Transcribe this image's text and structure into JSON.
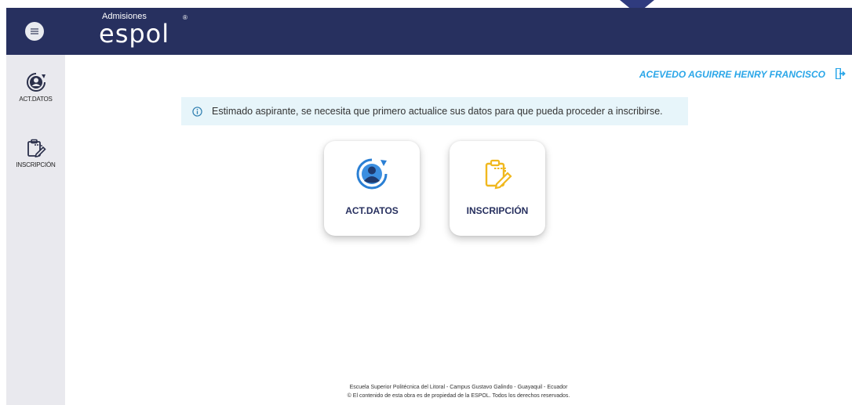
{
  "header": {
    "logo_small": "Admisiones",
    "logo_main": "espol",
    "logo_reg": "®"
  },
  "sidebar": {
    "items": [
      {
        "label": "ACT.DATOS",
        "icon": "user-refresh-icon"
      },
      {
        "label": "INSCRIPCIÓN",
        "icon": "clipboard-edit-icon"
      }
    ]
  },
  "user": {
    "name": "ACEVEDO AGUIRRE HENRY FRANCISCO"
  },
  "alert": {
    "message": "Estimado aspirante, se necesita que primero actualice sus datos para que pueda proceder a inscribirse."
  },
  "cards": [
    {
      "label": "ACT.DATOS",
      "icon": "user-refresh-icon"
    },
    {
      "label": "INSCRIPCIÓN",
      "icon": "clipboard-edit-icon"
    }
  ],
  "footer": {
    "line1": "Escuela Superior Politécnica del Litoral - Campus Gustavo Galindo - Guayaquil - Ecuador",
    "line2": "© El contenido de esta obra es de propiedad de la ESPOL. Todos los derechos reservados."
  },
  "colors": {
    "header_bg": "#27305f",
    "accent_blue": "#2aa6e8",
    "icon_yellow": "#f0b81e",
    "alert_bg": "#e7f5fa"
  }
}
